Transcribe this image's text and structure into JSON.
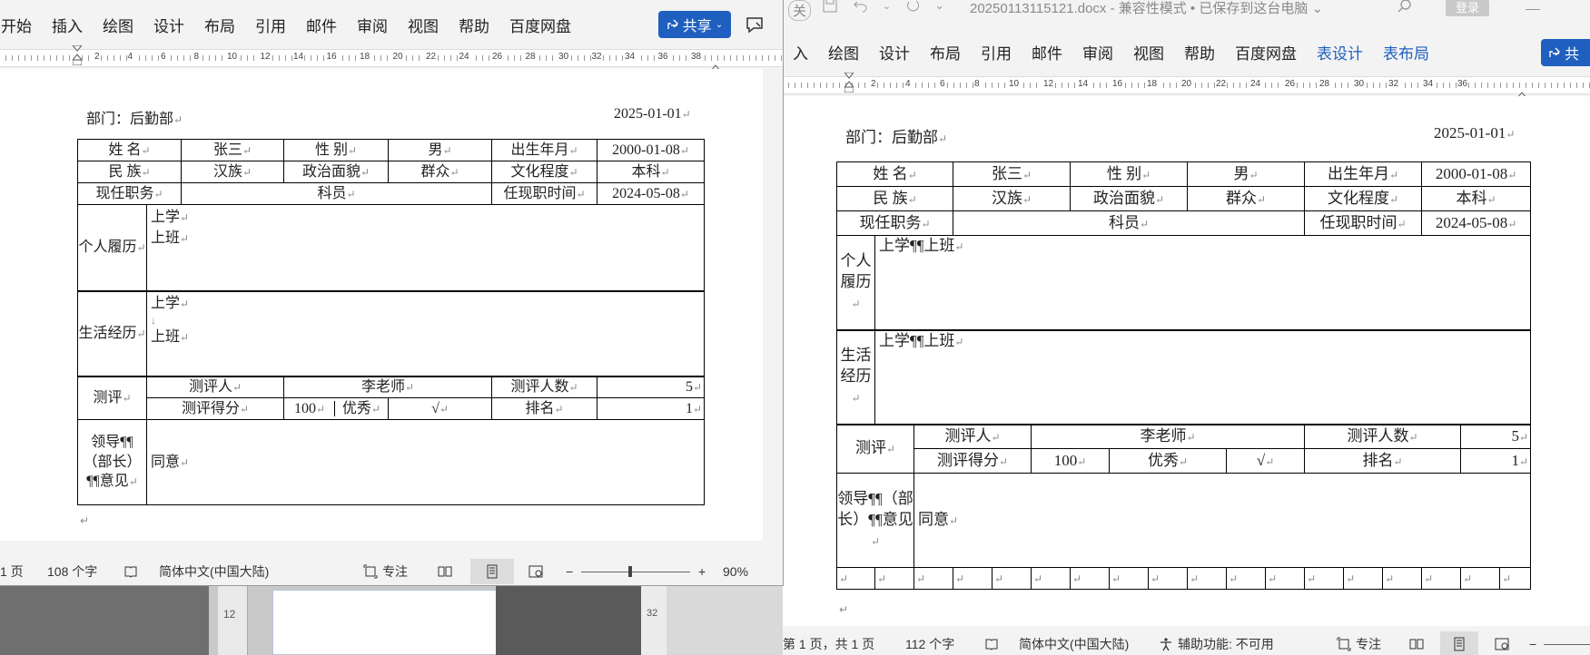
{
  "background": {
    "ruler_mark": "12",
    "ruler_mark_2": "32"
  },
  "left": {
    "menu": [
      "开始",
      "插入",
      "绘图",
      "设计",
      "布局",
      "引用",
      "邮件",
      "审阅",
      "视图",
      "帮助",
      "百度网盘"
    ],
    "share_label": "共享",
    "ruler_numbers": [
      "2",
      "4",
      "6",
      "8",
      "10",
      "12",
      "14",
      "16",
      "18",
      "20",
      "22",
      "24",
      "26",
      "28",
      "30",
      "32",
      "34",
      "36",
      "38"
    ],
    "doc": {
      "dept": "部门：后勤部",
      "date": "2025-01-01",
      "row1": [
        "姓  名",
        "张三",
        "性  别",
        "男",
        "出生年月",
        "2000-01-08"
      ],
      "row2": [
        "民  族",
        "汉族",
        "政治面貌",
        "群众",
        "文化程度",
        "本科"
      ],
      "row3": [
        "现任职务",
        "科员",
        "任现职时间",
        "2024-05-08"
      ],
      "resume_label": "个人履历",
      "resume_lines": [
        "上学",
        "上班"
      ],
      "life_label": "生活经历",
      "life_lines": [
        "上学",
        "↓",
        "上班"
      ],
      "eval_label": "测评",
      "eval_row1": [
        "测评人",
        "李老师",
        "测评人数",
        "5"
      ],
      "eval_row2": [
        "测评得分",
        "100",
        "优秀",
        "√",
        "排名",
        "1"
      ],
      "lead_label": "领导¶¶（部长）¶¶意见",
      "lead_text": "同意"
    },
    "status": {
      "page": "1 页",
      "words": "108 个字",
      "lang": "简体中文(中国大陆)",
      "focus": "专注",
      "zoom": "90%"
    }
  },
  "right": {
    "title_prefix": "关",
    "filename": "20250113115121.docx",
    "title_suffix": "兼容性模式 • 已保存到这台电脑",
    "login": "登录",
    "menu": [
      "入",
      "绘图",
      "设计",
      "布局",
      "引用",
      "邮件",
      "审阅",
      "视图",
      "帮助",
      "百度网盘"
    ],
    "menu_accent": [
      "表设计",
      "表布局"
    ],
    "share_label": "共",
    "ruler_numbers": [
      "2",
      "4",
      "6",
      "8",
      "10",
      "12",
      "14",
      "16",
      "18",
      "20",
      "22",
      "24",
      "26",
      "28",
      "30",
      "32",
      "34",
      "36"
    ],
    "doc": {
      "dept": "部门：后勤部",
      "date": "2025-01-01",
      "row1": [
        "姓  名",
        "张三",
        "性  别",
        "男",
        "出生年月",
        "2000-01-08"
      ],
      "row2": [
        "民  族",
        "汉族",
        "政治面貌",
        "群众",
        "文化程度",
        "本科"
      ],
      "row3": [
        "现任职务",
        "科员",
        "任现职时间",
        "2024-05-08"
      ],
      "resume_label": "个人履历",
      "resume_text": "上学¶¶上班",
      "life_label": "生活经历",
      "life_text": "上学¶¶上班",
      "eval_label": "测评",
      "eval_row1": [
        "测评人",
        "李老师",
        "测评人数",
        "5"
      ],
      "eval_row2": [
        "测评得分",
        "100",
        "优秀",
        "√",
        "排名",
        "1"
      ],
      "lead_label": "领导¶¶（部长）¶¶意见",
      "lead_text": "同意"
    },
    "status": {
      "page": "第 1 页，共 1 页",
      "words": "112 个字",
      "lang": "简体中文(中国大陆)",
      "access": "辅助功能: 不可用",
      "focus": "专注"
    }
  }
}
